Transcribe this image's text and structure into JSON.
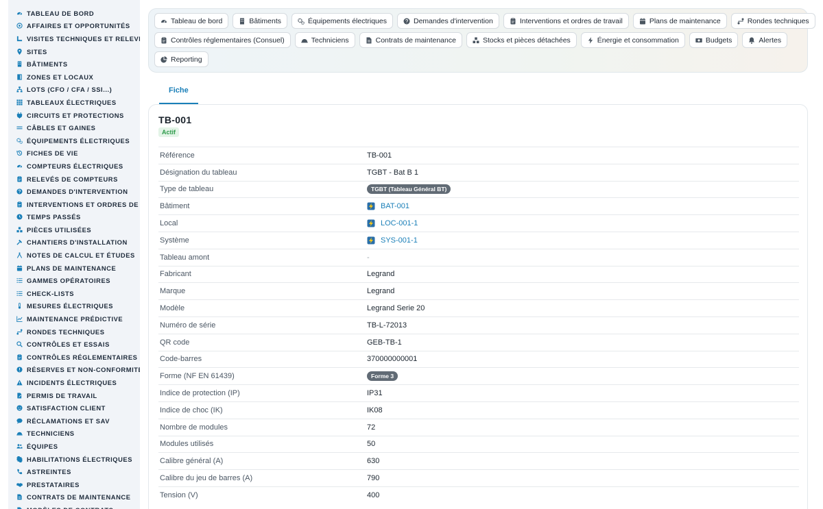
{
  "sidebar": {
    "items": [
      {
        "label": "TABLEAU DE BORD",
        "icon": "gauge-icon"
      },
      {
        "label": "AFFAIRES ET OPPORTUNITÉS",
        "icon": "target-icon"
      },
      {
        "label": "VISITES TECHNIQUES ET RELEVÉS",
        "icon": "ruler-icon"
      },
      {
        "label": "SITES",
        "icon": "pin-icon"
      },
      {
        "label": "BÂTIMENTS",
        "icon": "building-icon"
      },
      {
        "label": "ZONES ET LOCAUX",
        "icon": "door-icon"
      },
      {
        "label": "LOTS (CFO / CFA / SSI...)",
        "icon": "sitemap-icon"
      },
      {
        "label": "TABLEAUX ÉLECTRIQUES",
        "icon": "grid-icon"
      },
      {
        "label": "CIRCUITS ET PROTECTIONS",
        "icon": "plug-icon"
      },
      {
        "label": "CÂBLES ET GAINES",
        "icon": "lines-icon"
      },
      {
        "label": "ÉQUIPEMENTS ÉLECTRIQUES",
        "icon": "gears-icon"
      },
      {
        "label": "FICHES DE VIE",
        "icon": "history-icon"
      },
      {
        "label": "COMPTEURS ÉLECTRIQUES",
        "icon": "gauge-icon"
      },
      {
        "label": "RELEVÉS DE COMPTEURS",
        "icon": "clipboard-icon"
      },
      {
        "label": "DEMANDES D'INTERVENTION",
        "icon": "question-icon"
      },
      {
        "label": "INTERVENTIONS ET ORDRES DE TRAVAIL",
        "icon": "clipboard-icon"
      },
      {
        "label": "TEMPS PASSÉS",
        "icon": "clock-icon"
      },
      {
        "label": "PIÈCES UTILISÉES",
        "icon": "boxes-icon"
      },
      {
        "label": "CHANTIERS D'INSTALLATION",
        "icon": "hammer-icon"
      },
      {
        "label": "NOTES DE CALCUL ET ÉTUDES",
        "icon": "compass-icon"
      },
      {
        "label": "PLANS DE MAINTENANCE",
        "icon": "calendar-icon"
      },
      {
        "label": "GAMMES OPÉRATOIRES",
        "icon": "list-icon"
      },
      {
        "label": "CHECK-LISTS",
        "icon": "list-icon"
      },
      {
        "label": "MESURES ÉLECTRIQUES",
        "icon": "thermometer-icon"
      },
      {
        "label": "MAINTENANCE PRÉDICTIVE",
        "icon": "chart-icon"
      },
      {
        "label": "RONDES TECHNIQUES",
        "icon": "route-icon"
      },
      {
        "label": "CONTRÔLES ET ESSAIS",
        "icon": "search-icon"
      },
      {
        "label": "CONTRÔLES RÉGLEMENTAIRES",
        "icon": "clipboard-icon"
      },
      {
        "label": "RÉSERVES ET NON-CONFORMITÉS",
        "icon": "alert-circle-icon"
      },
      {
        "label": "INCIDENTS ÉLECTRIQUES",
        "icon": "warning-icon"
      },
      {
        "label": "PERMIS DE TRAVAIL",
        "icon": "file-pen-icon"
      },
      {
        "label": "SATISFACTION CLIENT",
        "icon": "smile-icon"
      },
      {
        "label": "RÉCLAMATIONS ET SAV",
        "icon": "comment-icon"
      },
      {
        "label": "TECHNICIENS",
        "icon": "helmet-icon"
      },
      {
        "label": "ÉQUIPES",
        "icon": "users-icon"
      },
      {
        "label": "HABILITATIONS ÉLECTRIQUES",
        "icon": "badge-icon"
      },
      {
        "label": "ASTREINTES",
        "icon": "phone-icon"
      },
      {
        "label": "PRESTATAIRES",
        "icon": "handshake-icon"
      },
      {
        "label": "CONTRATS DE MAINTENANCE",
        "icon": "file-icon"
      },
      {
        "label": "MODÈLES DE CONTRATS",
        "icon": "file-icon"
      }
    ]
  },
  "nav": {
    "rows": [
      [
        {
          "label": "Tableau de bord",
          "icon": "gauge-icon"
        },
        {
          "label": "Bâtiments",
          "icon": "building-icon"
        },
        {
          "label": "Équipements électriques",
          "icon": "gears-icon"
        },
        {
          "label": "Demandes d'intervention",
          "icon": "question-icon"
        },
        {
          "label": "Interventions et ordres de travail",
          "icon": "clipboard-icon"
        },
        {
          "label": "Plans de maintenance",
          "icon": "calendar-icon"
        },
        {
          "label": "Rondes techniques",
          "icon": "route-icon"
        }
      ],
      [
        {
          "label": "Contrôles réglementaires (Consuel)",
          "icon": "clipboard-icon"
        },
        {
          "label": "Techniciens",
          "icon": "helmet-icon"
        },
        {
          "label": "Contrats de maintenance",
          "icon": "file-icon"
        },
        {
          "label": "Stocks et pièces détachées",
          "icon": "boxes-icon"
        },
        {
          "label": "Énergie et consommation",
          "icon": "bolt-icon"
        },
        {
          "label": "Budgets",
          "icon": "money-icon"
        },
        {
          "label": "Alertes",
          "icon": "bell-icon"
        }
      ],
      [
        {
          "label": "Reporting",
          "icon": "pie-icon"
        }
      ]
    ]
  },
  "tabs": [
    {
      "label": "Fiche"
    }
  ],
  "record": {
    "title": "TB-001",
    "status": "Actif",
    "fields": [
      {
        "label": "Référence",
        "value": "TB-001",
        "kind": "text"
      },
      {
        "label": "Désignation du tableau",
        "value": "TGBT - Bat B 1",
        "kind": "text"
      },
      {
        "label": "Type de tableau",
        "value": "TGBT (Tableau Général BT)",
        "kind": "pill"
      },
      {
        "label": "Bâtiment",
        "value": "BAT-001",
        "kind": "link"
      },
      {
        "label": "Local",
        "value": "LOC-001-1",
        "kind": "link"
      },
      {
        "label": "Système",
        "value": "SYS-001-1",
        "kind": "link"
      },
      {
        "label": "Tableau amont",
        "value": "-",
        "kind": "empty"
      },
      {
        "label": "Fabricant",
        "value": "Legrand",
        "kind": "text"
      },
      {
        "label": "Marque",
        "value": "Legrand",
        "kind": "text"
      },
      {
        "label": "Modèle",
        "value": "Legrand Serie 20",
        "kind": "text"
      },
      {
        "label": "Numéro de série",
        "value": "TB-L-72013",
        "kind": "text"
      },
      {
        "label": "QR code",
        "value": "GEB-TB-1",
        "kind": "text"
      },
      {
        "label": "Code-barres",
        "value": "370000000001",
        "kind": "text"
      },
      {
        "label": "Forme (NF EN 61439)",
        "value": "Forme 3",
        "kind": "pill"
      },
      {
        "label": "Indice de protection (IP)",
        "value": "IP31",
        "kind": "text"
      },
      {
        "label": "Indice de choc (IK)",
        "value": "IK08",
        "kind": "text"
      },
      {
        "label": "Nombre de modules",
        "value": "72",
        "kind": "text"
      },
      {
        "label": "Modules utilisés",
        "value": "50",
        "kind": "text"
      },
      {
        "label": "Calibre général (A)",
        "value": "630",
        "kind": "text"
      },
      {
        "label": "Calibre du jeu de barres (A)",
        "value": "790",
        "kind": "text"
      },
      {
        "label": "Tension (V)",
        "value": "400",
        "kind": "text"
      }
    ]
  },
  "colors": {
    "accent": "#1a7fb8",
    "status": "#2d9a4a",
    "pill": "#616b75"
  }
}
